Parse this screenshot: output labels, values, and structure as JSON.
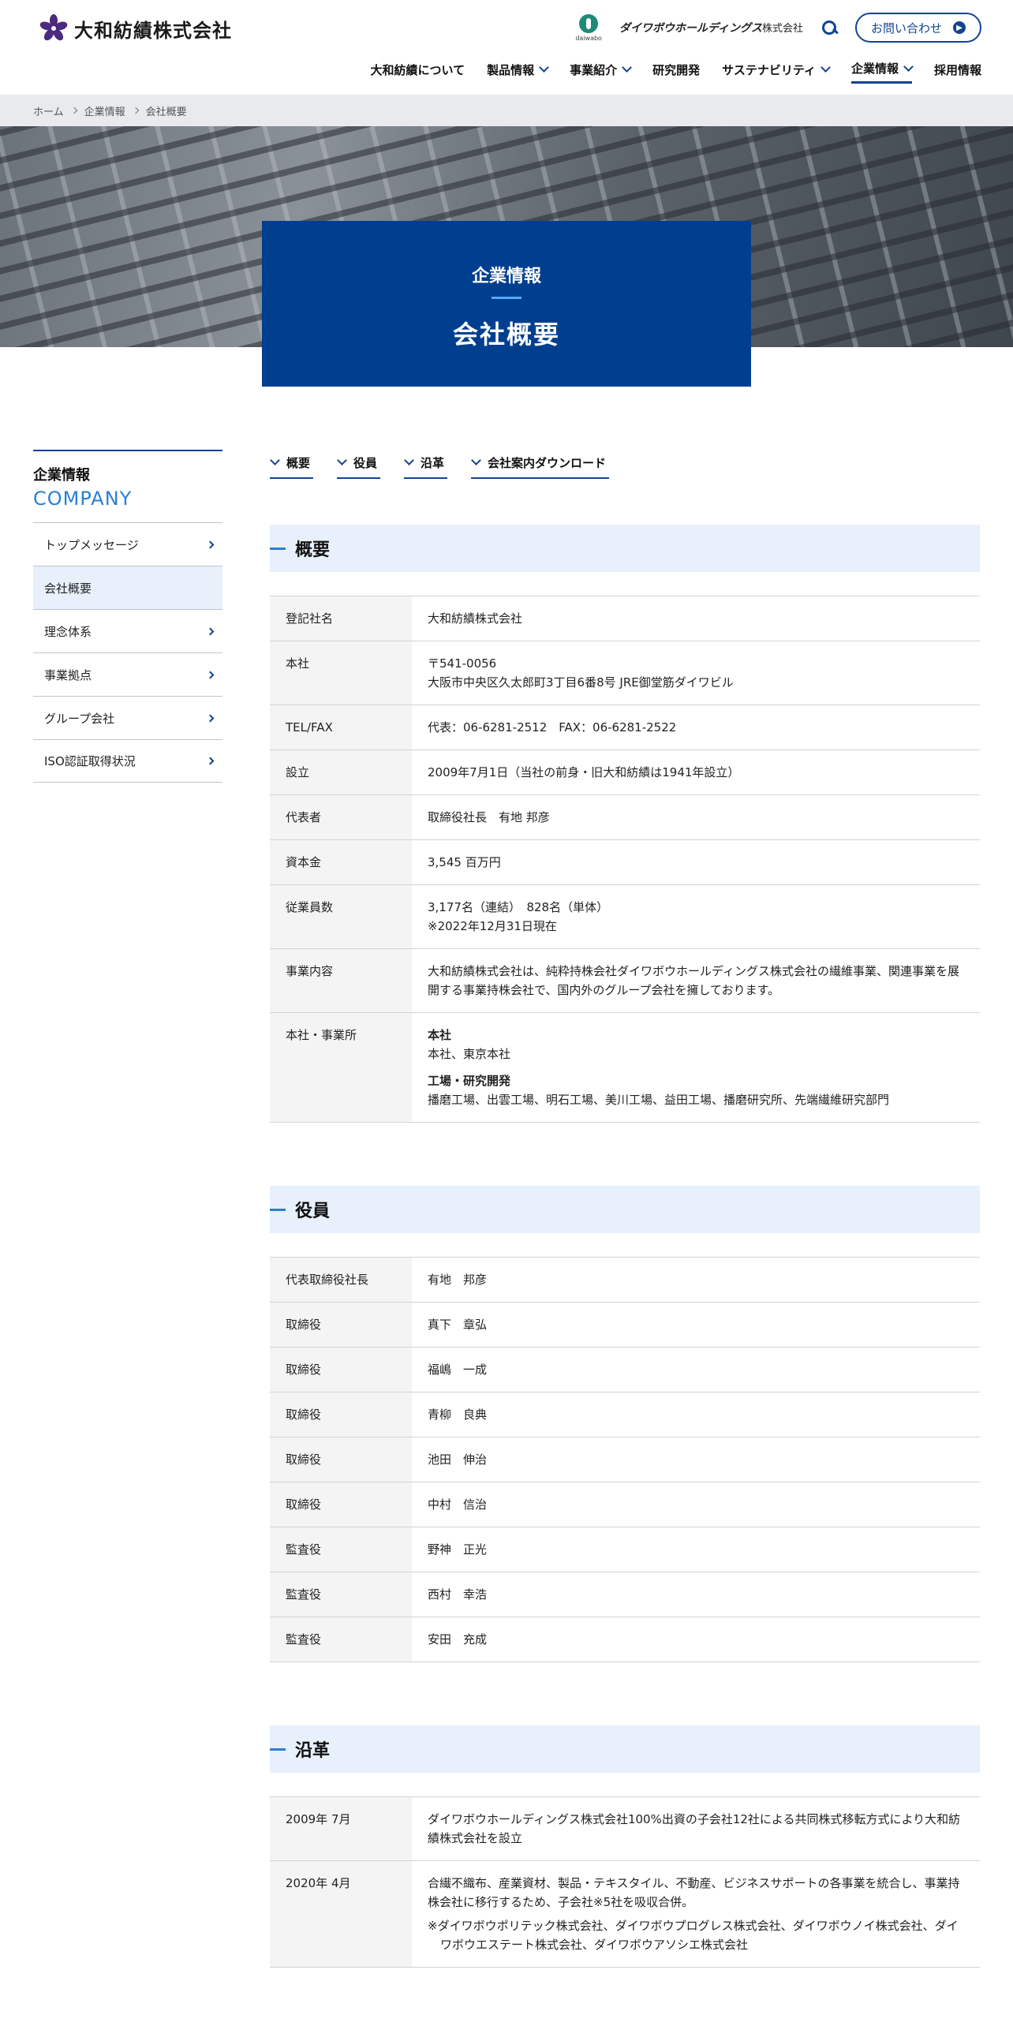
{
  "header": {
    "logo_text": "大和紡績株式会社",
    "dlabo_text": "daiwabo",
    "holdings_name": "ダイワボウホールディングス",
    "holdings_suffix": "株式会社",
    "contact_label": "お問い合わせ",
    "nav": [
      {
        "label": "大和紡績について",
        "dropdown": false,
        "active": false
      },
      {
        "label": "製品情報",
        "dropdown": true,
        "active": false
      },
      {
        "label": "事業紹介",
        "dropdown": true,
        "active": false
      },
      {
        "label": "研究開発",
        "dropdown": false,
        "active": false
      },
      {
        "label": "サステナビリティ",
        "dropdown": true,
        "active": false
      },
      {
        "label": "企業情報",
        "dropdown": true,
        "active": true
      },
      {
        "label": "採用情報",
        "dropdown": false,
        "active": false
      }
    ]
  },
  "breadcrumb": [
    "ホーム",
    "企業情報",
    "会社概要"
  ],
  "hero": {
    "subtitle": "企業情報",
    "title": "会社概要"
  },
  "sidebar": {
    "title_jp": "企業情報",
    "title_en": "COMPANY",
    "items": [
      {
        "label": "トップメッセージ",
        "active": false
      },
      {
        "label": "会社概要",
        "active": true
      },
      {
        "label": "理念体系",
        "active": false
      },
      {
        "label": "事業拠点",
        "active": false
      },
      {
        "label": "グループ会社",
        "active": false
      },
      {
        "label": "ISO認証取得状況",
        "active": false
      }
    ]
  },
  "anchors": [
    "概要",
    "役員",
    "沿革",
    "会社案内ダウンロード"
  ],
  "overview": {
    "heading": "概要",
    "rows": [
      {
        "label": "登記社名",
        "lines": [
          "大和紡績株式会社"
        ]
      },
      {
        "label": "本社",
        "lines": [
          "〒541-0056",
          "大阪市中央区久太郎町3丁目6番8号 JRE御堂筋ダイワビル"
        ]
      },
      {
        "label": "TEL/FAX",
        "lines": [
          "代表：06-6281-2512　FAX：06-6281-2522"
        ]
      },
      {
        "label": "設立",
        "lines": [
          "2009年7月1日（当社の前身・旧大和紡績は1941年設立）"
        ]
      },
      {
        "label": "代表者",
        "lines": [
          "取締役社長　有地 邦彦"
        ]
      },
      {
        "label": "資本金",
        "lines": [
          "3,545 百万円"
        ]
      },
      {
        "label": "従業員数",
        "lines": [
          "3,177名（連結）　828名（単体）",
          "※2022年12月31日現在"
        ]
      },
      {
        "label": "事業内容",
        "lines": [
          "大和紡績株式会社は、純粋持株会社ダイワボウホールディングス株式会社の繊維事業、関連事業を展開する事業持株会社で、国内外のグループ会社を擁しております。"
        ]
      }
    ],
    "offices": {
      "label": "本社・事業所",
      "groups": [
        {
          "title": "本社",
          "text": "本社、東京本社"
        },
        {
          "title": "工場・研究開発",
          "text": "播磨工場、出雲工場、明石工場、美川工場、益田工場、播磨研究所、先端繊維研究部門"
        }
      ]
    }
  },
  "officers": {
    "heading": "役員",
    "rows": [
      {
        "title": "代表取締役社長",
        "name": "有地　邦彦"
      },
      {
        "title": "取締役",
        "name": "真下　章弘"
      },
      {
        "title": "取締役",
        "name": "福嶋　一成"
      },
      {
        "title": "取締役",
        "name": "青柳　良典"
      },
      {
        "title": "取締役",
        "name": "池田　伸治"
      },
      {
        "title": "取締役",
        "name": "中村　信治"
      },
      {
        "title": "監査役",
        "name": "野神　正光"
      },
      {
        "title": "監査役",
        "name": "西村　幸浩"
      },
      {
        "title": "監査役",
        "name": "安田　充成"
      }
    ]
  },
  "history": {
    "heading": "沿革",
    "rows": [
      {
        "date": "2009年 7月",
        "text": "ダイワボウホールディングス株式会社100%出資の子会社12社による共同株式移転方式により大和紡績株式会社を設立",
        "notes": []
      },
      {
        "date": "2020年 4月",
        "text": "合繊不織布、産業資材、製品・テキスタイル、不動産、ビジネスサポートの各事業を統合し、事業持株会社に移行するため、子会社※5社を吸収合併。",
        "notes": [
          "※ダイワボウポリテック株式会社、ダイワボウプログレス株式会社、ダイワボウノイ株式会社、ダイワボウエステート株式会社、ダイワボウアソシエ株式会社"
        ]
      }
    ]
  }
}
